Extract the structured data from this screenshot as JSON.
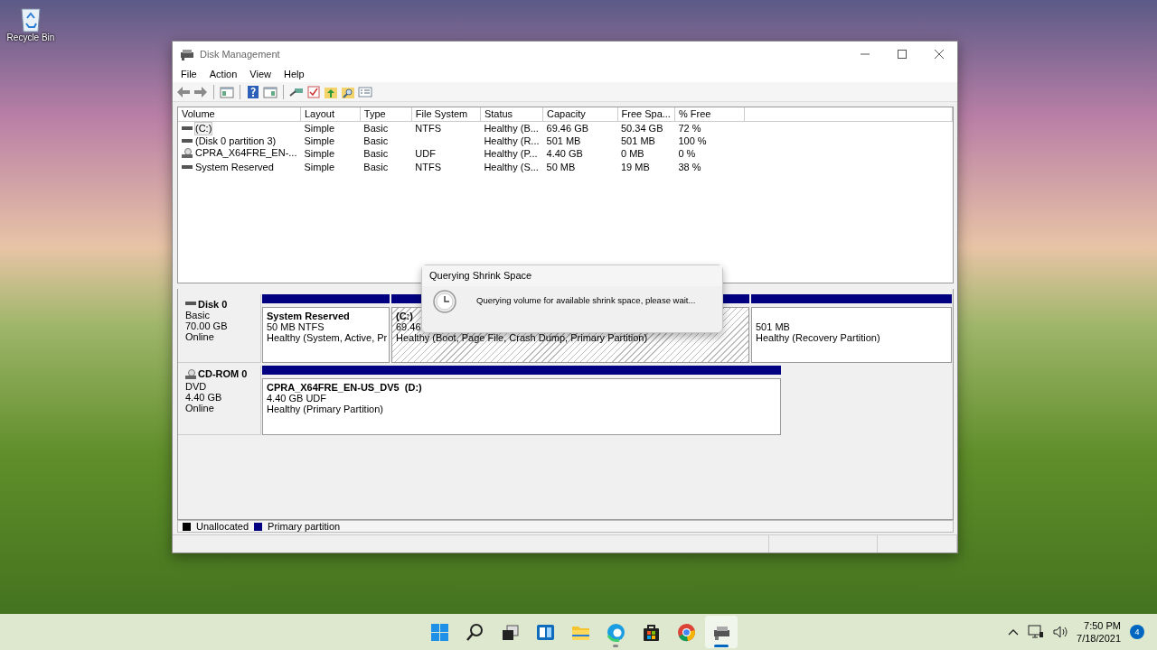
{
  "desktop_icons": [
    {
      "label": "Recycle Bin"
    }
  ],
  "window": {
    "title": "Disk Management",
    "menu": [
      "File",
      "Action",
      "View",
      "Help"
    ],
    "volume_table": {
      "columns": [
        "Volume",
        "Layout",
        "Type",
        "File System",
        "Status",
        "Capacity",
        "Free Spa...",
        "% Free"
      ],
      "rows": [
        {
          "kind": "disk",
          "selected": true,
          "cells": [
            "(C:)",
            "Simple",
            "Basic",
            "NTFS",
            "Healthy (B...",
            "69.46 GB",
            "50.34 GB",
            "72 %"
          ]
        },
        {
          "kind": "disk",
          "selected": false,
          "cells": [
            "(Disk 0 partition 3)",
            "Simple",
            "Basic",
            "",
            "Healthy (R...",
            "501 MB",
            "501 MB",
            "100 %"
          ]
        },
        {
          "kind": "cdrom",
          "selected": false,
          "cells": [
            "CPRA_X64FRE_EN-...",
            "Simple",
            "Basic",
            "UDF",
            "Healthy (P...",
            "4.40 GB",
            "0 MB",
            "0 %"
          ]
        },
        {
          "kind": "disk",
          "selected": false,
          "cells": [
            "System Reserved",
            "Simple",
            "Basic",
            "NTFS",
            "Healthy (S...",
            "50 MB",
            "19 MB",
            "38 %"
          ]
        }
      ]
    },
    "disks": [
      {
        "kind": "disk",
        "name": "Disk 0",
        "lines": [
          "Basic",
          "70.00 GB",
          "Online"
        ],
        "partitions": [
          {
            "title": "System Reserved",
            "lines": [
              "50 MB NTFS",
              "Healthy (System, Active, Pr"
            ],
            "selected": false
          },
          {
            "title": "(C:)",
            "lines": [
              "69.46",
              "Healthy (Boot, Page File, Crash Dump, Primary Partition)"
            ],
            "selected": true
          },
          {
            "lines": [
              "501 MB",
              "Healthy (Recovery Partition)"
            ],
            "selected": false
          }
        ]
      },
      {
        "kind": "cdrom",
        "name": "CD-ROM 0",
        "lines": [
          "DVD",
          "4.40 GB",
          "Online"
        ],
        "partitions": [
          {
            "title": "CPRA_X64FRE_EN-US_DV5  (D:)",
            "lines": [
              "4.40 GB UDF",
              "Healthy (Primary Partition)"
            ],
            "selected": false
          }
        ]
      }
    ],
    "legend": [
      {
        "label": "Unallocated",
        "color": "#000000"
      },
      {
        "label": "Primary partition",
        "color": "#000080"
      }
    ]
  },
  "dialog": {
    "title": "Querying Shrink Space",
    "message": "Querying volume for available shrink space, please wait..."
  },
  "taskbar": {
    "apps": [
      {
        "kind": "start",
        "selected": false,
        "running": false
      },
      {
        "kind": "search",
        "selected": false,
        "running": false
      },
      {
        "kind": "taskview",
        "selected": false,
        "running": false
      },
      {
        "kind": "widgets",
        "selected": false,
        "running": false
      },
      {
        "kind": "folder",
        "selected": false,
        "running": false
      },
      {
        "kind": "edge",
        "selected": false,
        "running": true
      },
      {
        "kind": "store",
        "selected": false,
        "running": false
      },
      {
        "kind": "chrome",
        "selected": false,
        "running": false
      },
      {
        "kind": "diskmgmt",
        "selected": true,
        "running": true
      }
    ],
    "time": "7:50 PM",
    "date": "7/18/2021",
    "notifications": "4"
  }
}
